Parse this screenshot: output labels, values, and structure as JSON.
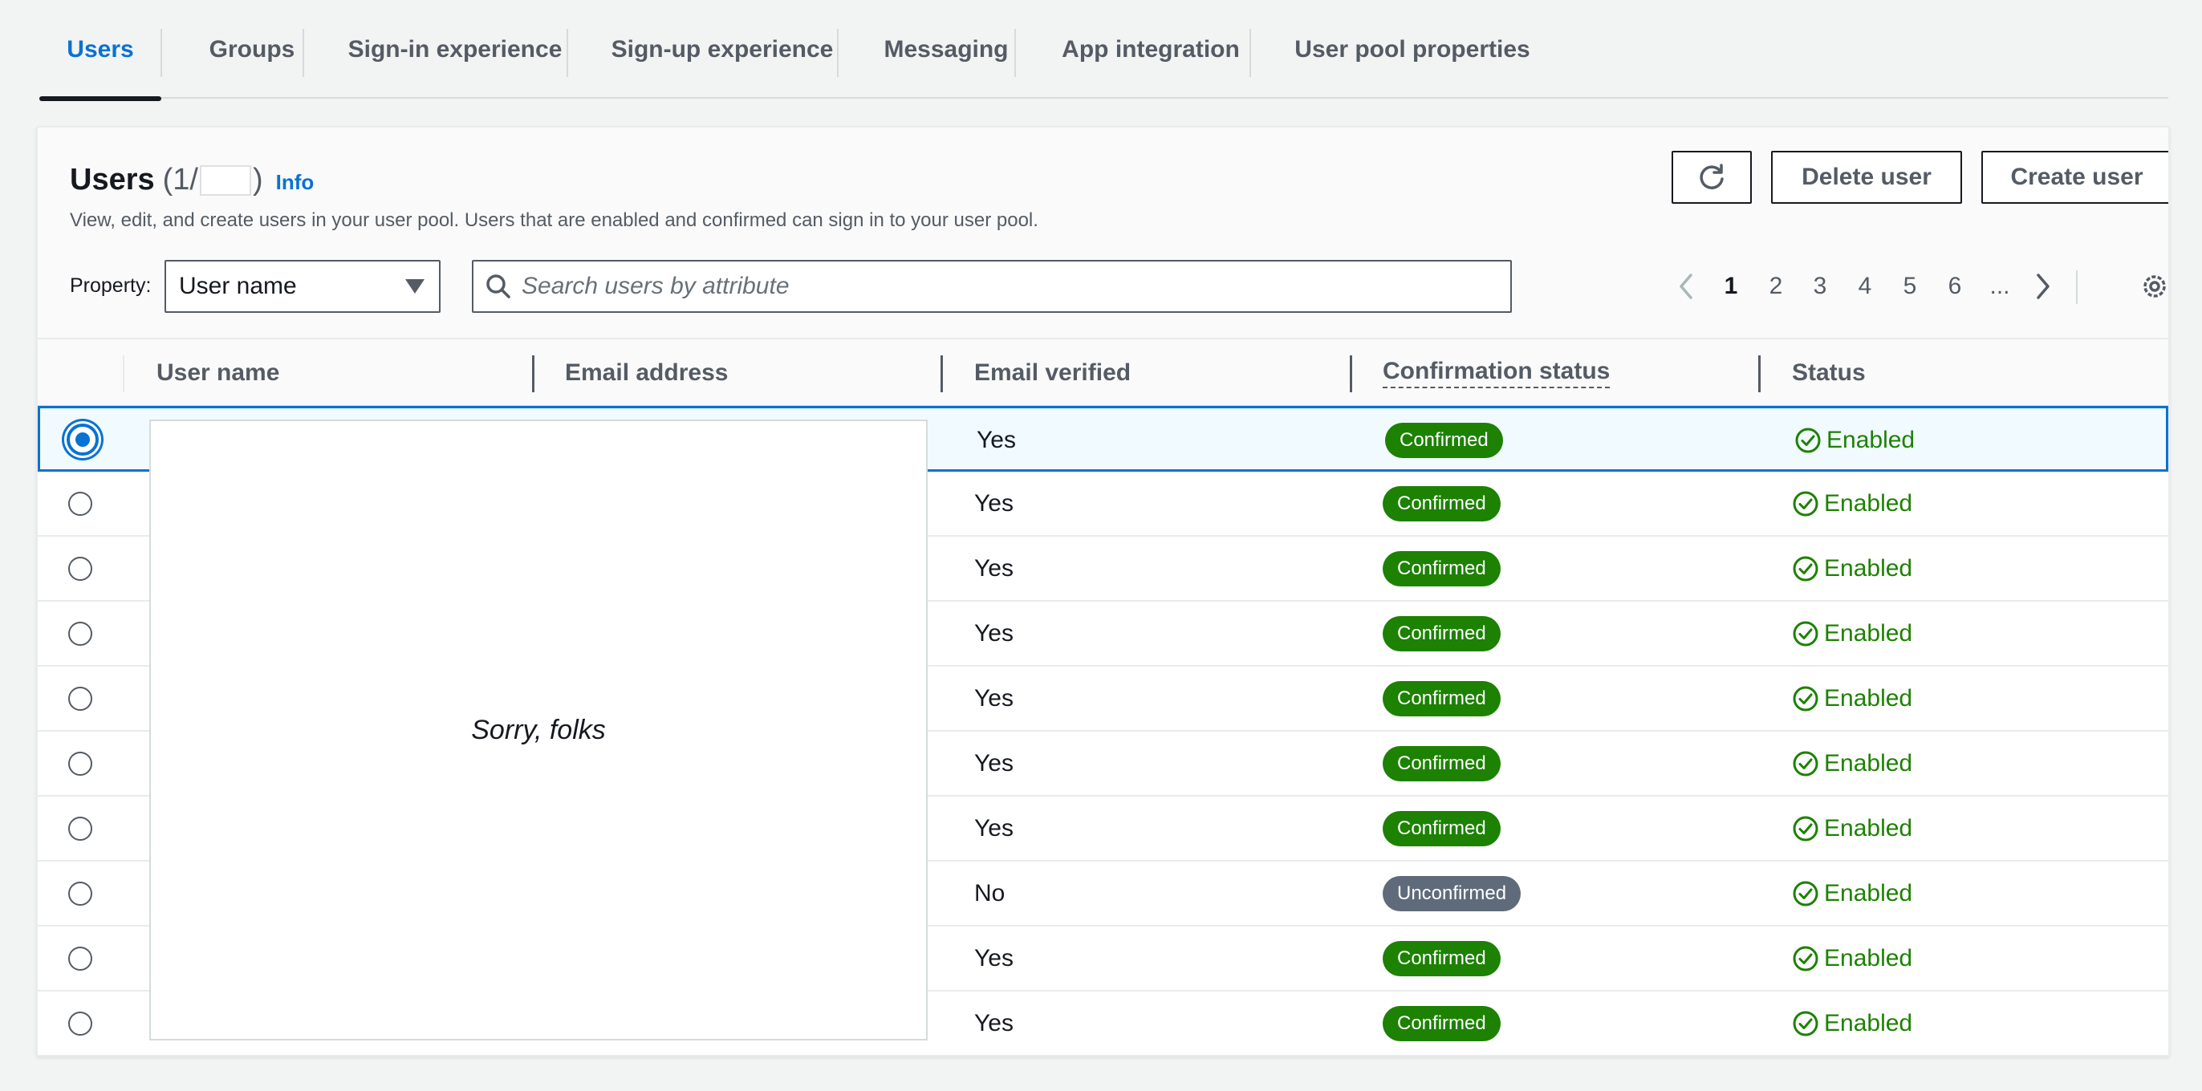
{
  "tabs": [
    {
      "label": "Users",
      "active": true
    },
    {
      "label": "Groups"
    },
    {
      "label": "Sign-in experience"
    },
    {
      "label": "Sign-up experience"
    },
    {
      "label": "Messaging"
    },
    {
      "label": "App integration"
    },
    {
      "label": "User pool properties"
    }
  ],
  "header": {
    "title": "Users",
    "count_prefix": "(1/",
    "count_suffix": ")",
    "info": "Info",
    "description": "View, edit, and create users in your user pool. Users that are enabled and confirmed can sign in to your user pool.",
    "delete_label": "Delete user",
    "create_label": "Create user"
  },
  "filter": {
    "property_label": "Property:",
    "property_value": "User name",
    "search_placeholder": "Search users by attribute"
  },
  "pagination": {
    "pages": [
      "1",
      "2",
      "3",
      "4",
      "5",
      "6"
    ],
    "ellipsis": "...",
    "current": "1"
  },
  "table": {
    "columns": [
      "User name",
      "Email address",
      "Email verified",
      "Confirmation status",
      "Status"
    ],
    "rows": [
      {
        "email_verified": "Yes",
        "confirmation": "Confirmed",
        "status": "Enabled",
        "selected": true
      },
      {
        "email_verified": "Yes",
        "confirmation": "Confirmed",
        "status": "Enabled"
      },
      {
        "email_verified": "Yes",
        "confirmation": "Confirmed",
        "status": "Enabled"
      },
      {
        "email_verified": "Yes",
        "confirmation": "Confirmed",
        "status": "Enabled"
      },
      {
        "email_verified": "Yes",
        "confirmation": "Confirmed",
        "status": "Enabled"
      },
      {
        "email_verified": "Yes",
        "confirmation": "Confirmed",
        "status": "Enabled"
      },
      {
        "email_verified": "Yes",
        "confirmation": "Confirmed",
        "status": "Enabled"
      },
      {
        "email_verified": "No",
        "confirmation": "Unconfirmed",
        "status": "Enabled"
      },
      {
        "email_verified": "Yes",
        "confirmation": "Confirmed",
        "status": "Enabled"
      },
      {
        "email_verified": "Yes",
        "confirmation": "Confirmed",
        "status": "Enabled"
      }
    ]
  },
  "overlay": {
    "text": "Sorry, folks"
  },
  "colors": {
    "accent": "#0972d3",
    "success": "#1d8102",
    "neutral_badge": "#5f6b7a"
  },
  "icons": {
    "refresh": "refresh-icon",
    "search": "search-icon",
    "settings": "gear-icon",
    "status": "check-circle-icon"
  }
}
